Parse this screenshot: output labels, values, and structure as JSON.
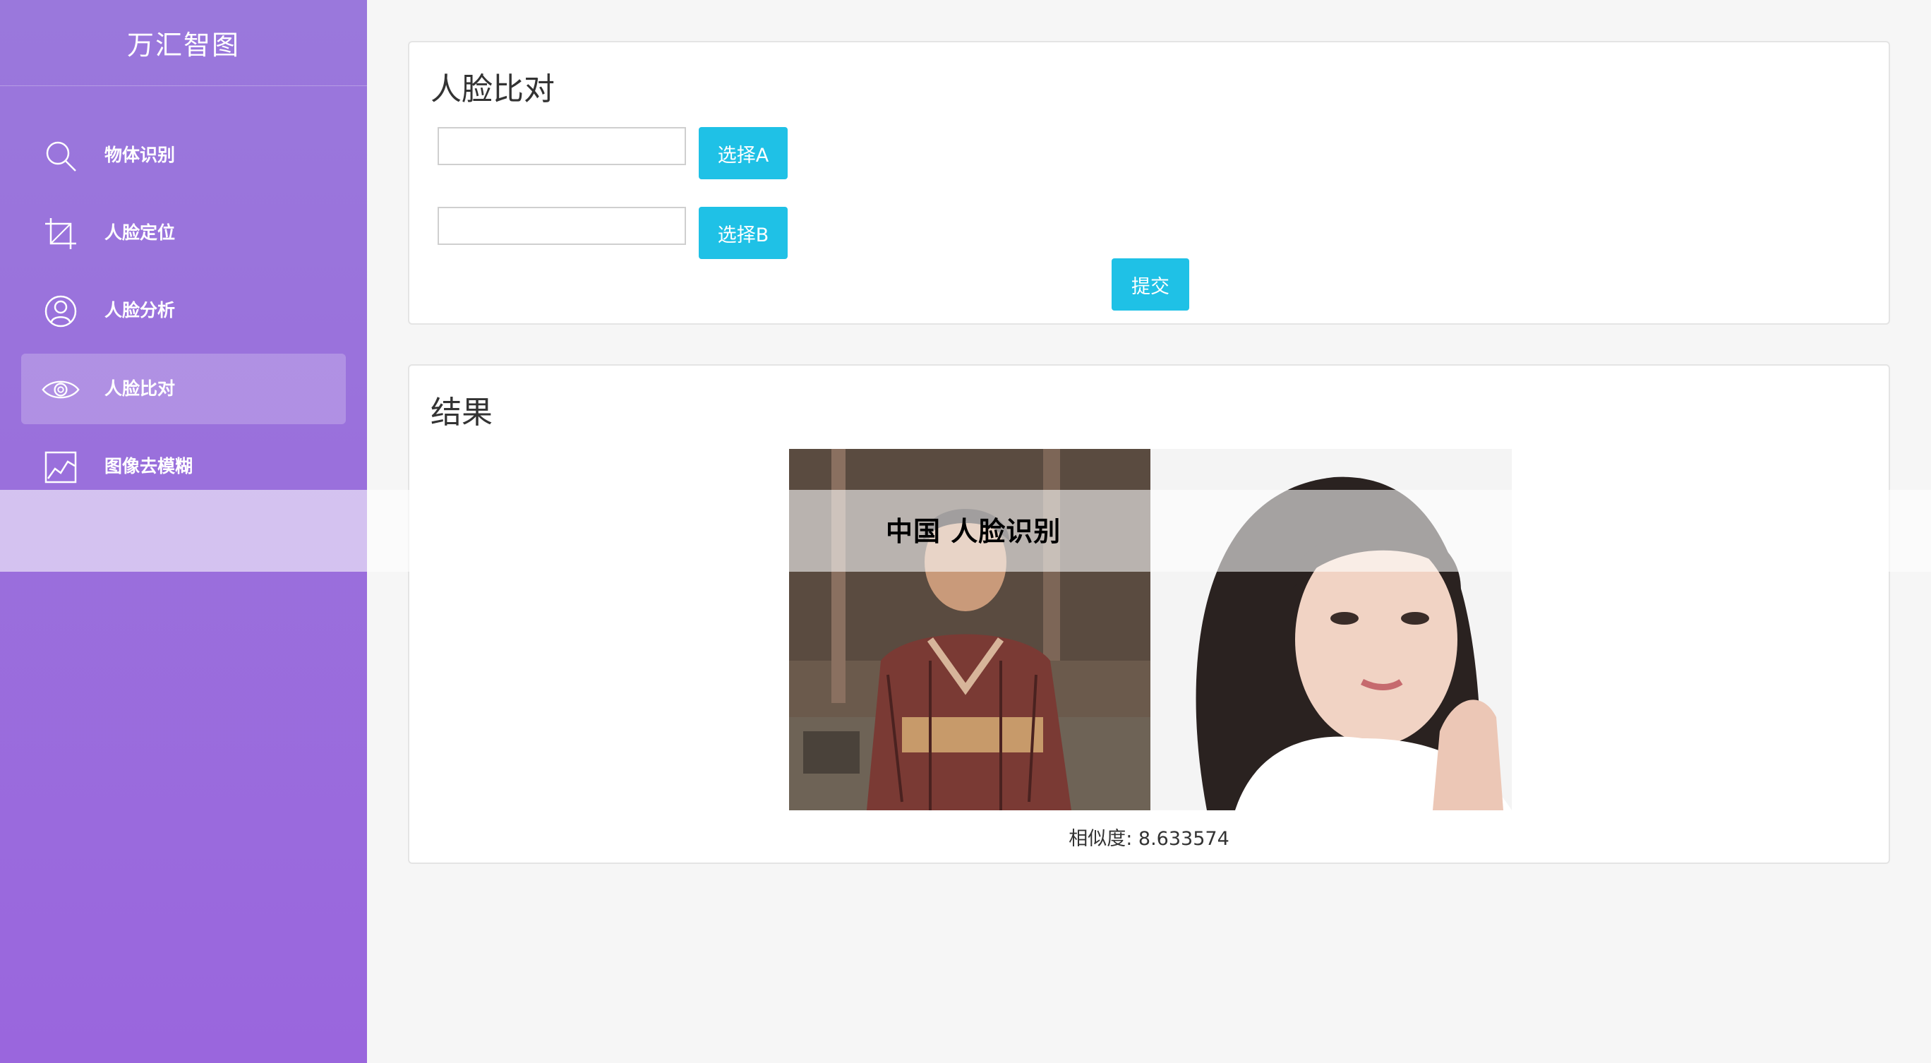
{
  "sidebar": {
    "brand": "万汇智图",
    "items": [
      {
        "label": "物体识别",
        "icon": "search-icon",
        "active": false
      },
      {
        "label": "人脸定位",
        "icon": "crop-icon",
        "active": false
      },
      {
        "label": "人脸分析",
        "icon": "user-icon",
        "active": false
      },
      {
        "label": "人脸比对",
        "icon": "eye-icon",
        "active": true
      },
      {
        "label": "图像去模糊",
        "icon": "line-chart-icon",
        "active": false
      }
    ]
  },
  "compare": {
    "title": "人脸比对",
    "input_a_value": "",
    "input_b_value": "",
    "select_a_label": "选择A",
    "select_b_label": "选择B",
    "submit_label": "提交"
  },
  "result": {
    "title": "结果",
    "similarity_text": "相似度: 8.633574",
    "image_a": "woman-in-kimono-photo",
    "image_b": "woman-portrait-photo"
  },
  "overlay": {
    "text": "中国 人脸识别"
  },
  "colors": {
    "sidebar": "#9a6fdc",
    "accent": "#1fc1e6",
    "background": "#f6f6f6"
  }
}
